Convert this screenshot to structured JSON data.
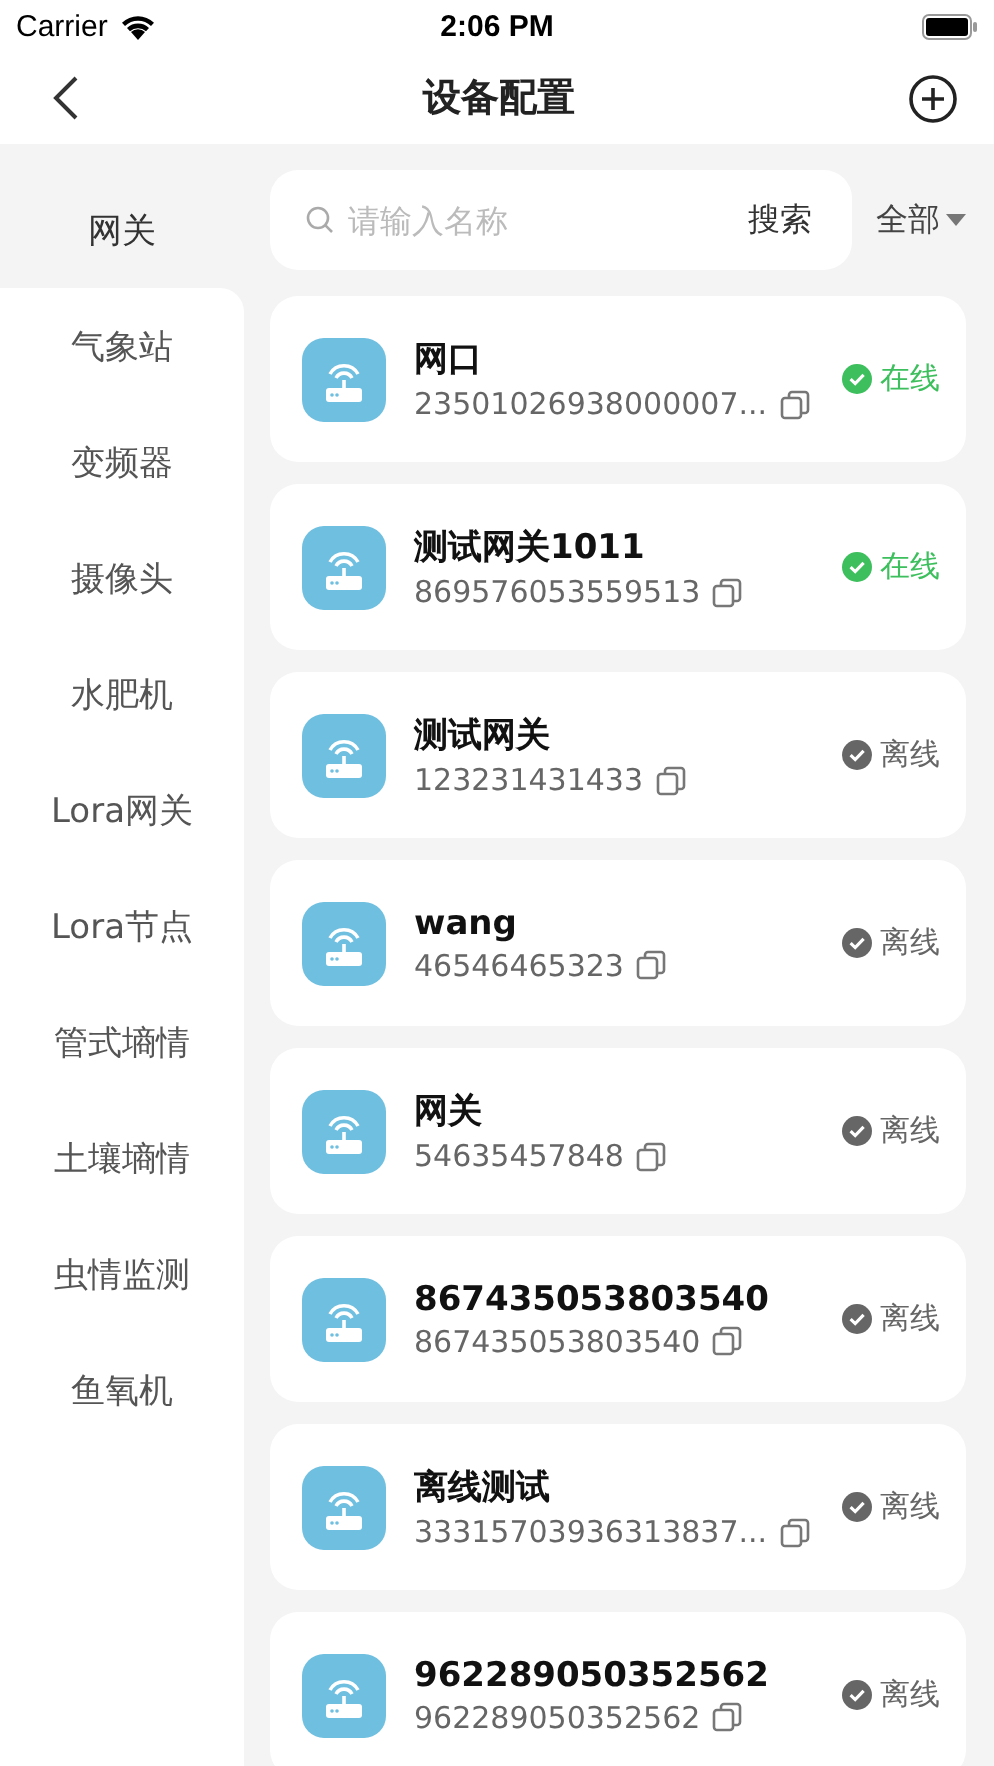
{
  "status_bar": {
    "carrier": "Carrier",
    "time": "2:06 PM"
  },
  "nav": {
    "title": "设备配置"
  },
  "search": {
    "placeholder": "请输入名称",
    "button": "搜索",
    "filter": "全部"
  },
  "categories": [
    {
      "label": "网关",
      "selected": true
    },
    {
      "label": "气象站",
      "selected": false
    },
    {
      "label": "变频器",
      "selected": false
    },
    {
      "label": "摄像头",
      "selected": false
    },
    {
      "label": "水肥机",
      "selected": false
    },
    {
      "label": "Lora网关",
      "selected": false
    },
    {
      "label": "Lora节点",
      "selected": false
    },
    {
      "label": "管式墒情",
      "selected": false
    },
    {
      "label": "土壤墒情",
      "selected": false
    },
    {
      "label": "虫情监测",
      "selected": false
    },
    {
      "label": "鱼氧机",
      "selected": false
    }
  ],
  "devices": [
    {
      "name": "网口",
      "serial": "23501026938000007...",
      "status": "在线",
      "online": true
    },
    {
      "name": "测试网关1011",
      "serial": "869576053559513",
      "status": "在线",
      "online": true
    },
    {
      "name": "测试网关",
      "serial": "123231431433",
      "status": "离线",
      "online": false
    },
    {
      "name": "wang",
      "serial": "46546465323",
      "status": "离线",
      "online": false
    },
    {
      "name": "网关",
      "serial": "54635457848",
      "status": "离线",
      "online": false
    },
    {
      "name": "867435053803540",
      "serial": "867435053803540",
      "status": "离线",
      "online": false
    },
    {
      "name": "离线测试",
      "serial": "33315703936313837...",
      "status": "离线",
      "online": false
    },
    {
      "name": "962289050352562",
      "serial": "962289050352562",
      "status": "离线",
      "online": false
    }
  ]
}
